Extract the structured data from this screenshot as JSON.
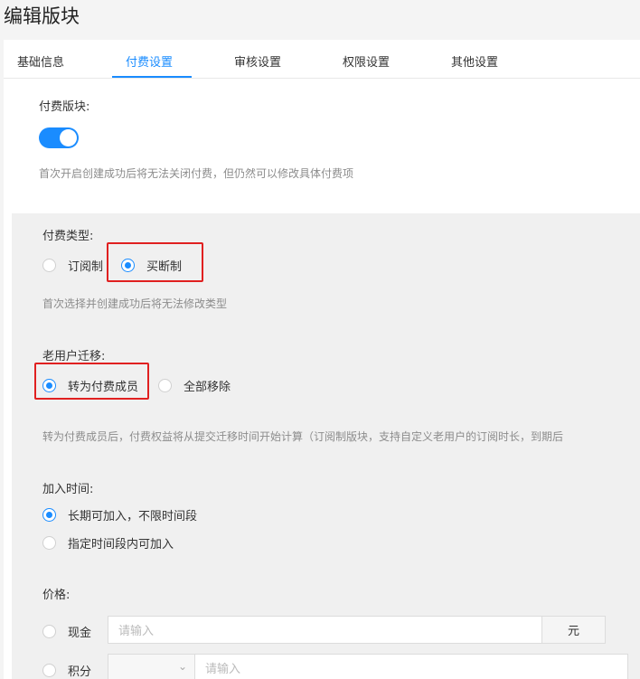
{
  "page": {
    "title": "编辑版块"
  },
  "tabs": [
    {
      "label": "基础信息"
    },
    {
      "label": "付费设置"
    },
    {
      "label": "审核设置"
    },
    {
      "label": "权限设置"
    },
    {
      "label": "其他设置"
    }
  ],
  "active_tab": "付费设置",
  "paid_block": {
    "label": "付费版块:",
    "enabled": true,
    "hint": "首次开启创建成功后将无法关闭付费，但仍然可以修改具体付费项"
  },
  "pay_type": {
    "label": "付费类型:",
    "options": [
      "订阅制",
      "买断制"
    ],
    "selected": "买断制",
    "hint": "首次选择并创建成功后将无法修改类型"
  },
  "migration": {
    "label": "老用户迁移:",
    "options": [
      "转为付费成员",
      "全部移除"
    ],
    "selected": "转为付费成员",
    "hint": "转为付费成员后，付费权益将从提交迁移时间开始计算（订阅制版块，支持自定义老用户的订阅时长，到期后"
  },
  "join_time": {
    "label": "加入时间:",
    "options": [
      "长期可加入，不限时间段",
      "指定时间段内可加入"
    ],
    "selected": "长期可加入，不限时间段"
  },
  "price": {
    "label": "价格:",
    "cash": {
      "label": "现金",
      "placeholder": "请输入",
      "unit": "元"
    },
    "points": {
      "label": "积分",
      "placeholder": "请输入"
    }
  },
  "colors": {
    "accent": "#1a8cff",
    "highlight": "#e02020",
    "panel_bg": "#f0f0f0"
  }
}
